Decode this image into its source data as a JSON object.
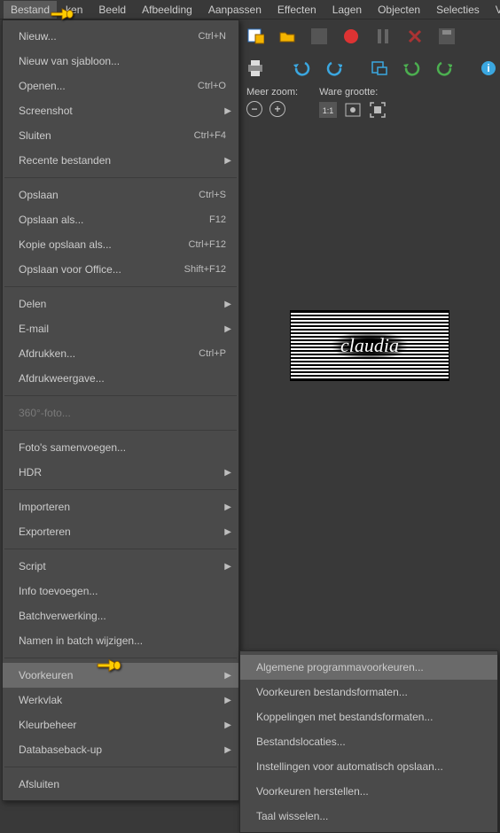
{
  "menubar": {
    "items": [
      {
        "label": "Bestand",
        "active": true
      },
      {
        "label": "ken"
      },
      {
        "label": "Beeld"
      },
      {
        "label": "Afbeelding"
      },
      {
        "label": "Aanpassen"
      },
      {
        "label": "Effecten"
      },
      {
        "label": "Lagen"
      },
      {
        "label": "Objecten"
      },
      {
        "label": "Selecties"
      },
      {
        "label": "Vens"
      }
    ]
  },
  "file_menu": [
    {
      "label": "Nieuw...",
      "shortcut": "Ctrl+N"
    },
    {
      "label": "Nieuw van sjabloon..."
    },
    {
      "label": "Openen...",
      "shortcut": "Ctrl+O"
    },
    {
      "label": "Screenshot",
      "submenu": true
    },
    {
      "label": "Sluiten",
      "shortcut": "Ctrl+F4"
    },
    {
      "label": "Recente bestanden",
      "submenu": true
    },
    {
      "sep": true
    },
    {
      "label": "Opslaan",
      "shortcut": "Ctrl+S"
    },
    {
      "label": "Opslaan als...",
      "shortcut": "F12"
    },
    {
      "label": "Kopie opslaan als...",
      "shortcut": "Ctrl+F12"
    },
    {
      "label": "Opslaan voor Office...",
      "shortcut": "Shift+F12"
    },
    {
      "sep": true
    },
    {
      "label": "Delen",
      "submenu": true
    },
    {
      "label": "E-mail",
      "submenu": true
    },
    {
      "label": "Afdrukken...",
      "shortcut": "Ctrl+P"
    },
    {
      "label": "Afdrukweergave..."
    },
    {
      "sep": true
    },
    {
      "label": "360°-foto...",
      "disabled": true
    },
    {
      "sep": true
    },
    {
      "label": "Foto's samenvoegen..."
    },
    {
      "label": "HDR",
      "submenu": true
    },
    {
      "sep": true
    },
    {
      "label": "Importeren",
      "submenu": true
    },
    {
      "label": "Exporteren",
      "submenu": true
    },
    {
      "sep": true
    },
    {
      "label": "Script",
      "submenu": true
    },
    {
      "label": "Info toevoegen..."
    },
    {
      "label": "Batchverwerking..."
    },
    {
      "label": "Namen in batch wijzigen..."
    },
    {
      "sep": true
    },
    {
      "label": "Voorkeuren",
      "submenu": true,
      "hovered": true
    },
    {
      "label": "Werkvlak",
      "submenu": true
    },
    {
      "label": "Kleurbeheer",
      "submenu": true
    },
    {
      "label": "Databaseback-up",
      "submenu": true
    },
    {
      "sep": true
    },
    {
      "label": "Afsluiten"
    }
  ],
  "voorkeuren_submenu": [
    {
      "label": "Algemene programmavoorkeuren...",
      "hovered": true
    },
    {
      "label": "Voorkeuren bestandsformaten..."
    },
    {
      "label": "Koppelingen met bestandsformaten..."
    },
    {
      "label": "Bestandslocaties..."
    },
    {
      "label": "Instellingen voor automatisch opslaan..."
    },
    {
      "label": "Voorkeuren herstellen..."
    },
    {
      "label": "Taal wisselen..."
    }
  ],
  "toolbar": {
    "zoom_label": "Meer zoom:",
    "size_label": "Ware grootte:"
  },
  "logo_text": "claudia"
}
